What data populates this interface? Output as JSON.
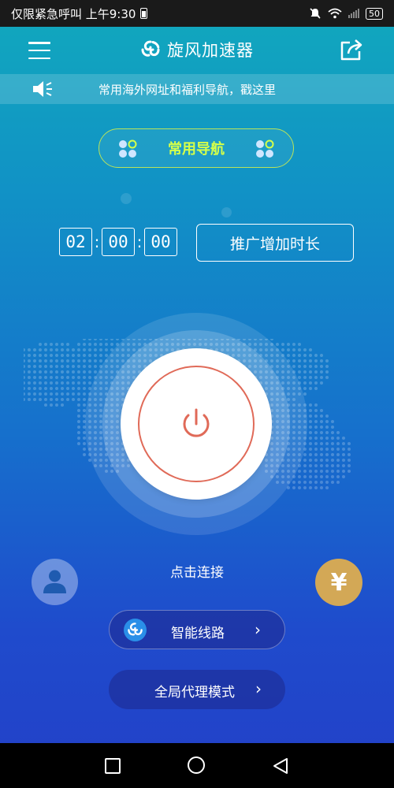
{
  "status_bar": {
    "carrier_text": "仅限紧急呼叫 上午9:30",
    "battery_level": "50"
  },
  "header": {
    "title": "旋风加速器",
    "menu_icon": "menu-icon",
    "share_icon": "share-icon"
  },
  "notice": {
    "text": "常用海外网址和福利导航，戳这里",
    "icon": "speaker-icon"
  },
  "nav_button": {
    "label": "常用导航"
  },
  "timer": {
    "hours": "02",
    "minutes": "00",
    "seconds": "00",
    "separator": ":"
  },
  "extend_button": {
    "label": "推广增加时长"
  },
  "connect": {
    "label": "点击连接"
  },
  "pay_button": {
    "label": "¥"
  },
  "route": {
    "label": "智能线路",
    "chevron": "›"
  },
  "mode": {
    "label": "全局代理模式",
    "chevron": "›"
  },
  "colors": {
    "accent_green": "#d4ff4a",
    "power_red": "#e06a58",
    "gold": "#d3a856"
  }
}
